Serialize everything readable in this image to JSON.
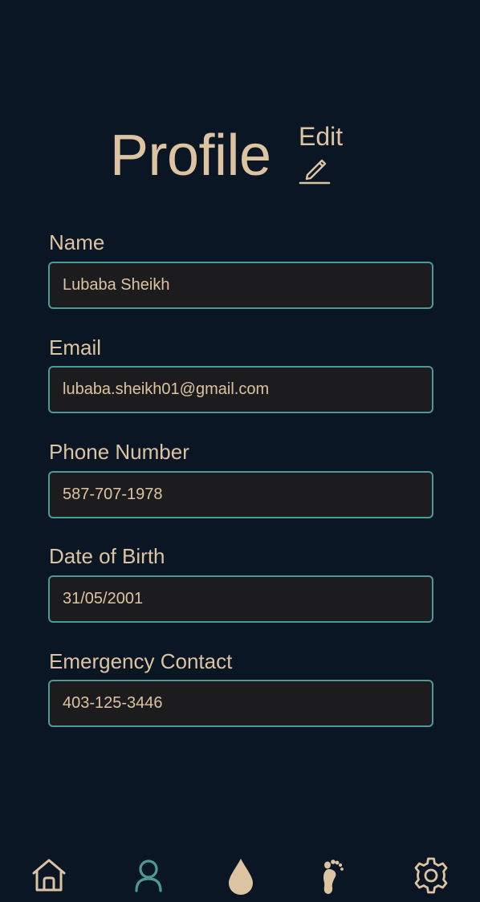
{
  "header": {
    "title": "Profile",
    "edit_label": "Edit",
    "edit_icon": "pencil-icon"
  },
  "fields": [
    {
      "label": "Name",
      "value": "Lubaba Sheikh"
    },
    {
      "label": "Email",
      "value": "lubaba.sheikh01@gmail.com"
    },
    {
      "label": "Phone Number",
      "value": "587-707-1978"
    },
    {
      "label": "Date of Birth",
      "value": "31/05/2001"
    },
    {
      "label": "Emergency Contact",
      "value": "403-125-3446"
    }
  ],
  "bottom_nav": {
    "items": [
      {
        "icon": "home-icon",
        "active": false
      },
      {
        "icon": "person-icon",
        "active": true
      },
      {
        "icon": "droplet-icon",
        "active": false
      },
      {
        "icon": "footprint-icon",
        "active": false
      },
      {
        "icon": "gear-icon",
        "active": false
      }
    ]
  },
  "colors": {
    "background": "#0b1624",
    "text": "#dcc3a2",
    "field_border": "#4c9a93",
    "field_background": "#1c1c1e",
    "active_icon": "#4c9a93"
  }
}
